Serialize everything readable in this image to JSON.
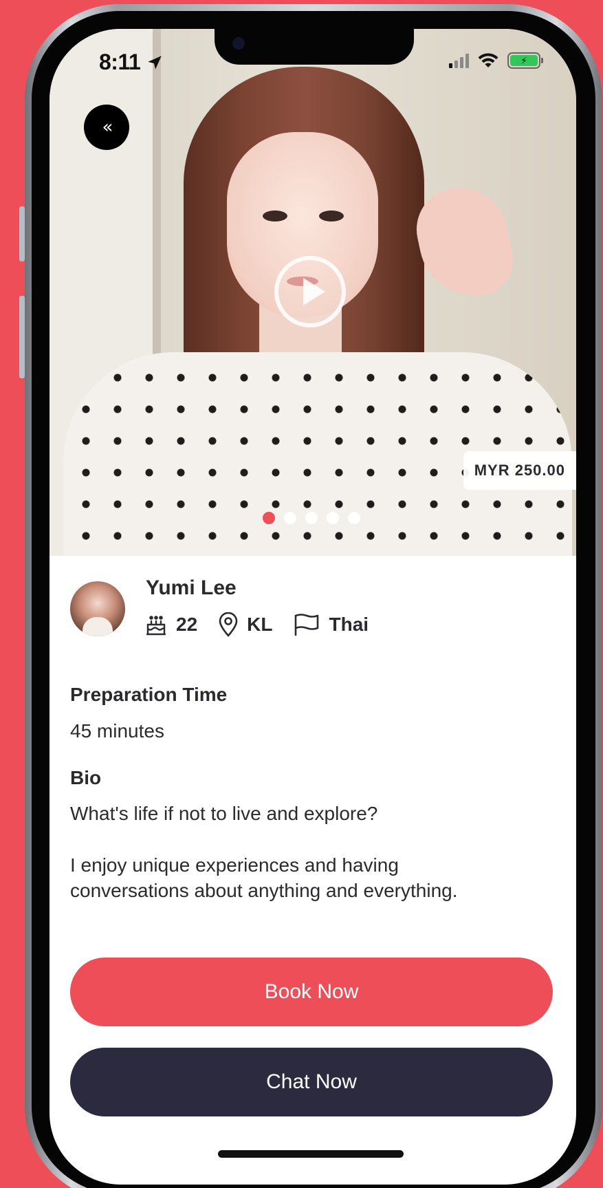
{
  "status_bar": {
    "time": "8:11"
  },
  "media": {
    "price": "MYR 250.00",
    "photo_count": 5,
    "active_photo_index": 0
  },
  "profile": {
    "name": "Yumi Lee",
    "age": "22",
    "location": "KL",
    "language": "Thai"
  },
  "preparation": {
    "label": "Preparation Time",
    "value": "45 minutes"
  },
  "bio": {
    "label": "Bio",
    "line1": "What's life if not to live and explore?",
    "line2": "I enjoy unique experiences and having",
    "line3": "conversations about anything and everything."
  },
  "actions": {
    "book_label": "Book Now",
    "chat_label": "Chat Now"
  },
  "colors": {
    "accent": "#ee4e57",
    "dark_button": "#2c2a3f",
    "text": "#2b2a2e"
  },
  "icons": [
    "back-chevrons-icon",
    "play-icon",
    "birthday-cake-icon",
    "location-pin-icon",
    "flag-icon",
    "signal-icon",
    "wifi-icon",
    "battery-charging-icon"
  ]
}
